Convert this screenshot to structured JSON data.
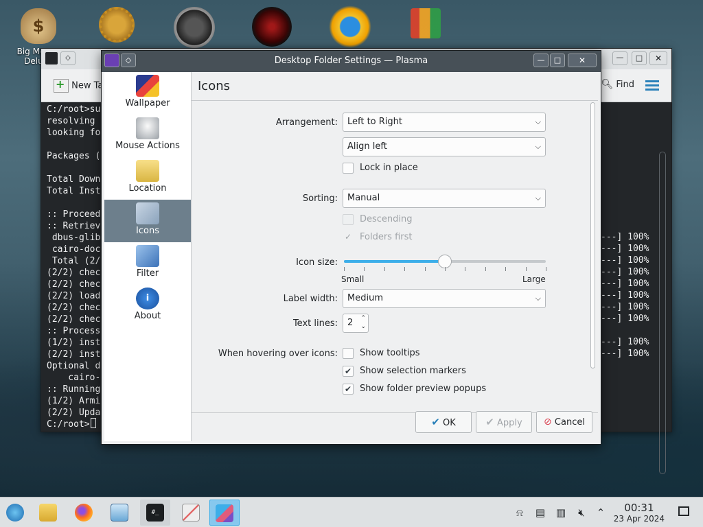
{
  "desktop": {
    "icons": [
      {
        "label": "Big Money Deluxe",
        "icon": "money-bag-icon"
      },
      {
        "label": "",
        "icon": "gear-icon"
      },
      {
        "label": "",
        "icon": "speedometer-icon"
      },
      {
        "label": "",
        "icon": "red-dragon-icon"
      },
      {
        "label": "",
        "icon": "sun-globe-icon"
      },
      {
        "label": "",
        "icon": "office-grid-icon"
      }
    ]
  },
  "terminal": {
    "toolbar": {
      "new_tab": "New Tab",
      "find": "Find"
    },
    "lines": [
      "C:/root>su",
      "resolving ",
      "looking fo",
      "",
      "Packages (",
      "",
      "Total Down",
      "Total Inst",
      "",
      ":: Proceed",
      ":: Retriev",
      " dbus-glib",
      " cairo-doc",
      " Total (2/",
      "(2/2) chec",
      "(2/2) chec",
      "(2/2) load",
      "(2/2) chec",
      "(2/2) chec",
      ":: Process",
      "(1/2) inst",
      "(2/2) inst",
      "Optional d",
      "    cairo-",
      ":: Running",
      "(1/2) Armi",
      "(2/2) Upda",
      "C:/root>"
    ],
    "right_lines": [
      "---] 100%",
      "---] 100%",
      "---] 100%",
      "---] 100%",
      "---] 100%",
      "---] 100%",
      "---] 100%",
      "---] 100%",
      "",
      "---] 100%",
      "---] 100%"
    ]
  },
  "dialog": {
    "title": "Desktop Folder Settings — Plasma",
    "sidebar": [
      {
        "label": "Wallpaper",
        "icon": "wallpaper-icon",
        "active": false
      },
      {
        "label": "Mouse Actions",
        "icon": "mouse-icon",
        "active": false
      },
      {
        "label": "Location",
        "icon": "folder-icon",
        "active": false
      },
      {
        "label": "Icons",
        "icon": "icons-icon",
        "active": true
      },
      {
        "label": "Filter",
        "icon": "filter-icon",
        "active": false
      },
      {
        "label": "About",
        "icon": "info-icon",
        "active": false
      }
    ],
    "page_title": "Icons",
    "arrangement": {
      "label": "Arrangement:",
      "value": "Left to Right"
    },
    "alignment": {
      "value": "Align left"
    },
    "lock_in_place": {
      "label": "Lock in place",
      "checked": false
    },
    "sorting": {
      "label": "Sorting:",
      "value": "Manual"
    },
    "descending": {
      "label": "Descending",
      "checked": false,
      "disabled": true
    },
    "folders_first": {
      "label": "Folders first",
      "checked": true,
      "disabled": true
    },
    "icon_size": {
      "label": "Icon size:",
      "min_label": "Small",
      "max_label": "Large",
      "value": 0.5
    },
    "label_width": {
      "label": "Label width:",
      "value": "Medium"
    },
    "text_lines": {
      "label": "Text lines:",
      "value": "2"
    },
    "hover": {
      "label": "When hovering over icons:"
    },
    "show_tooltips": {
      "label": "Show tooltips",
      "checked": false
    },
    "show_selection_markers": {
      "label": "Show selection markers",
      "checked": true
    },
    "show_folder_preview": {
      "label": "Show folder preview popups",
      "checked": true
    },
    "buttons": {
      "ok": "OK",
      "apply": "Apply",
      "cancel": "Cancel"
    }
  },
  "taskbar": {
    "time": "00:31",
    "date": "23 Apr 2024"
  },
  "colors": {
    "accent": "#3daee9",
    "dialog_title": "#475057",
    "sidebar_active": "#6d7f8c"
  }
}
